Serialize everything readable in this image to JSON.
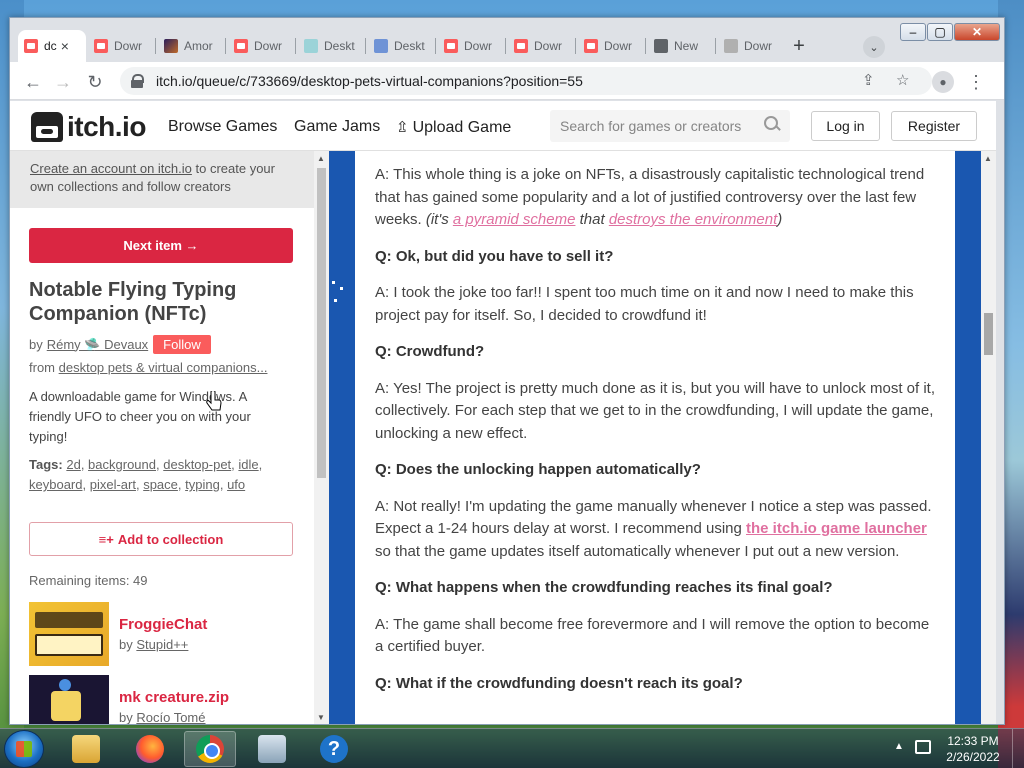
{
  "browser": {
    "tabs": [
      {
        "label": "dc",
        "icon": "itch-favicon",
        "active": true
      },
      {
        "label": "Dowr",
        "icon": "itch-favicon"
      },
      {
        "label": "Amor",
        "icon": "amor-favicon"
      },
      {
        "label": "Dowr",
        "icon": "itch-favicon"
      },
      {
        "label": "Deskt",
        "icon": "desktop-favicon"
      },
      {
        "label": "Deskt",
        "icon": "desktop-favicon"
      },
      {
        "label": "Dowr",
        "icon": "itch-favicon"
      },
      {
        "label": "Dowr",
        "icon": "itch-favicon"
      },
      {
        "label": "Dowr",
        "icon": "itch-favicon"
      },
      {
        "label": "New",
        "icon": "newtab-favicon"
      },
      {
        "label": "Dowr",
        "icon": "download-favicon"
      }
    ],
    "url": "itch.io/queue/c/733669/desktop-pets-virtual-companions?position=55"
  },
  "header": {
    "logo": "itch.io",
    "nav": [
      "Browse Games",
      "Game Jams",
      "Upload Game"
    ],
    "search_placeholder": "Search for games or creators",
    "login": "Log in",
    "register": "Register"
  },
  "sidebar": {
    "promo_link": "Create an account on itch.io",
    "promo_text": " to create your own collections and follow creators",
    "next_button": "Next item →",
    "game_title": "Notable Flying Typing Companion (NFTc)",
    "by_label": "by",
    "author": "Rémy 🛸 Devaux",
    "follow": "Follow",
    "from_label": "from ",
    "collection": "desktop pets & virtual companions...",
    "description": "A downloadable game for Windows. A friendly UFO to cheer you on with your typing!",
    "tags_label": "Tags:",
    "tags": [
      "2d",
      "background",
      "desktop-pet",
      "idle",
      "keyboard",
      "pixel-art",
      "space",
      "typing",
      "ufo"
    ],
    "add_to_collection": "Add to collection",
    "remaining": "Remaining items: 49",
    "related": [
      {
        "title": "FroggieChat",
        "by_label": "by",
        "author": "Stupid++"
      },
      {
        "title": "mk creature.zip",
        "by_label": "by",
        "author": "Rocío Tomé"
      }
    ]
  },
  "content": {
    "p1_text": "A: This whole thing is a joke on NFTs, a disastrously capitalistic technological trend that has gained some popularity and a lot of justified controversy over the last few weeks. ",
    "p1_it1": "(it's ",
    "p1_link1": "a pyramid scheme",
    "p1_it2": " that ",
    "p1_link2": "destroys the environment",
    "p1_it3": ")",
    "q2": "Q: Ok, but did you have to sell it?",
    "a2": "A: I took the joke too far!! I spent too much time on it and now I need to make this project pay for itself. So, I decided to crowdfund it!",
    "q3": "Q: Crowdfund?",
    "a3": "A: Yes! The project is pretty much done as it is, but you will have to unlock most of it, collectively. For each step that we get to in the crowdfunding, I will update the game, unlocking a new effect.",
    "q4": "Q: Does the unlocking happen automatically?",
    "a4_pre": "A: Not really! I'm updating the game manually whenever I notice a step was passed. Expect a 1-24 hours delay at worst. I recommend using ",
    "a4_link": "the itch.io game launcher",
    "a4_post": " so that the game updates itself automatically whenever I put out a new version.",
    "q5": "Q: What happens when the crowdfunding reaches its final goal?",
    "a5": "A: The game shall become free forevermore and I will remove the option to become a certified buyer.",
    "q6": "Q: What if the crowdfunding doesn't reach its goal?"
  },
  "taskbar": {
    "apps": [
      "file-explorer",
      "firefox",
      "chrome",
      "resource-monitor",
      "help"
    ],
    "time": "12:33 PM",
    "date": "2/26/2022"
  },
  "colors": {
    "itch_red": "#da2642",
    "page_bg": "#1a57b0",
    "link_pink": "#e070a0"
  }
}
